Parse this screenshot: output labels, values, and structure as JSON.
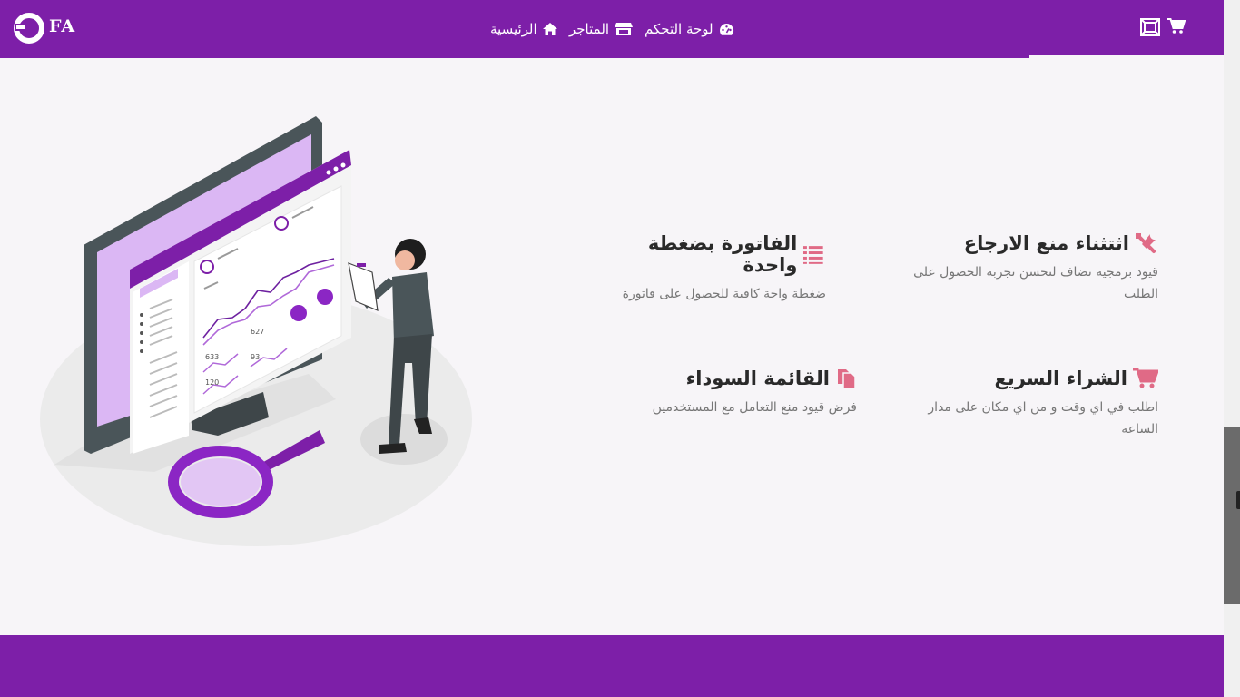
{
  "brand": {
    "logo_text": "FA"
  },
  "nav": {
    "dashboard": "لوحة التحكم",
    "stores": "المتاجر",
    "home": "الرئيسية"
  },
  "features": [
    {
      "title": "اثتثناء منع الارجاع",
      "desc": "قيود برمجية تضاف لتحسن تجربة الحصول على الطلب",
      "icon": "tools-icon"
    },
    {
      "title": "الفاتورة بضغطة واحدة",
      "desc": "ضغطة واحة كافية للحصول على فاتورة",
      "icon": "list-icon"
    },
    {
      "title": "الشراء السريع",
      "desc": "اطلب في اي وقت و من اي مكان على مدار الساعة",
      "icon": "cart-icon"
    },
    {
      "title": "القائمة السوداء",
      "desc": "فرض قيود منع التعامل مع المستخدمين",
      "icon": "copy-icon"
    }
  ],
  "illustration": {
    "labels": [
      "627",
      "633",
      "93",
      "120"
    ]
  },
  "colors": {
    "brand": "#7d1fa8",
    "accent_icon": "#e06a86",
    "text": "#2a2a2a",
    "muted": "#777777"
  }
}
